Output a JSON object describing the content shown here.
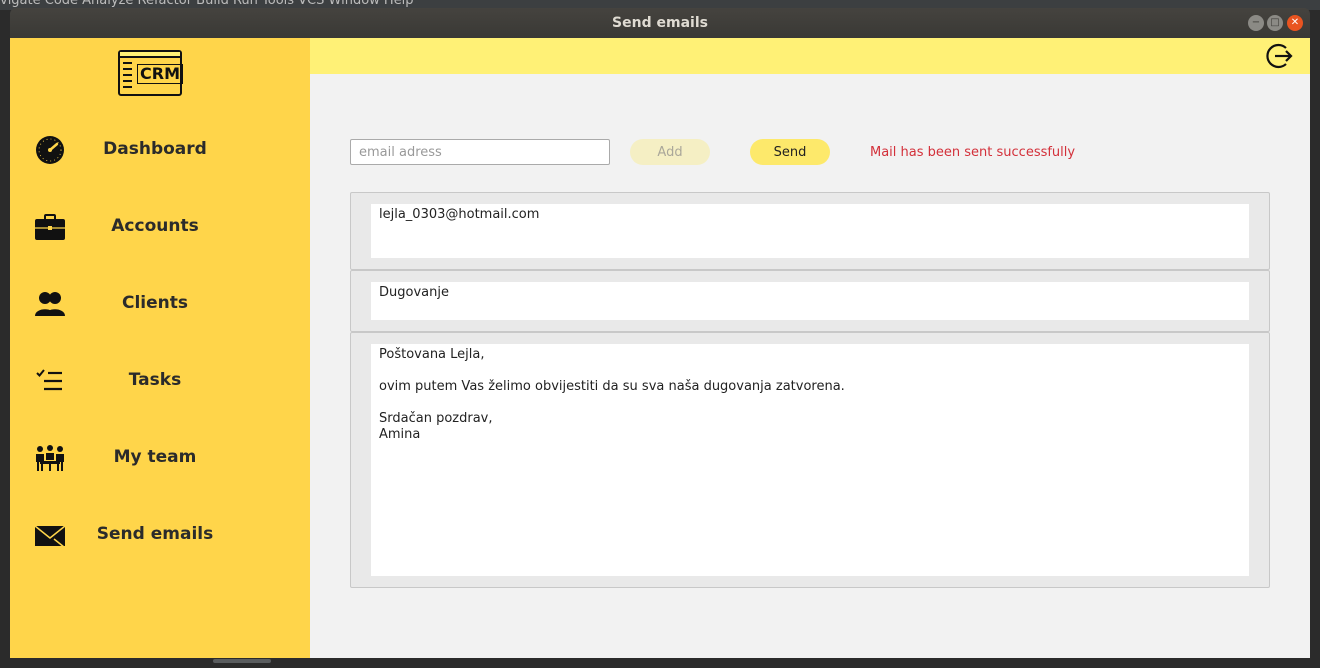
{
  "ide": {
    "menubar_text": "vigate  Code  Analyze  Refactor  Build  Run  Tools  VCS  Window  Help"
  },
  "window": {
    "title": "Send emails"
  },
  "sidebar": {
    "logo_text": "CRM",
    "items": [
      {
        "label": "Dashboard",
        "icon": "dashboard-gauge-icon"
      },
      {
        "label": "Accounts",
        "icon": "briefcase-icon"
      },
      {
        "label": "Clients",
        "icon": "users-icon"
      },
      {
        "label": "Tasks",
        "icon": "checklist-icon"
      },
      {
        "label": "My team",
        "icon": "team-icon"
      },
      {
        "label": "Send emails",
        "icon": "envelope-icon"
      }
    ]
  },
  "header": {
    "logout_icon": "logout-icon"
  },
  "form": {
    "email_placeholder": "email adress",
    "add_label": "Add",
    "send_label": "Send",
    "status_message": "Mail has been sent successfully"
  },
  "mail": {
    "recipients": "lejla_0303@hotmail.com",
    "subject": "Dugovanje",
    "body": "Poštovana Lejla,\n\novim putem Vas želimo obvijestiti da su sva naša dugovanja zatvorena.\n\nSrdačan pozdrav,\nAmina"
  },
  "colors": {
    "sidebar_bg": "#ffd54a",
    "topbar_bg": "#fff176",
    "send_button": "#fde96b",
    "status_text": "#d3303a"
  }
}
